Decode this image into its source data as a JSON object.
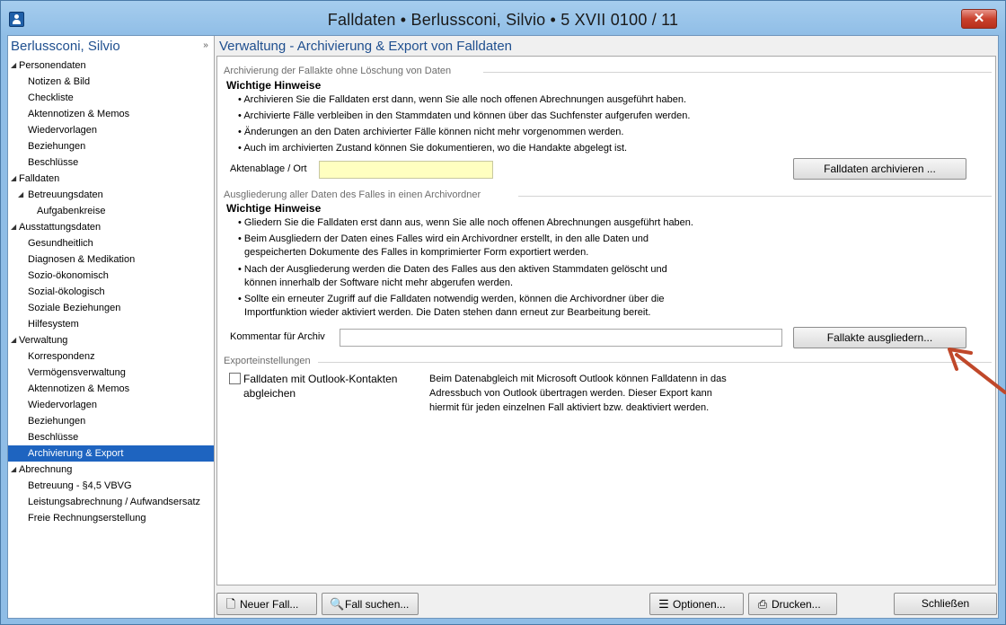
{
  "window": {
    "title": "Falldaten  •  Berlussconi, Silvio  •  5 XVII 0100 / 11",
    "close_label": "✕"
  },
  "sidebar": {
    "title": "Berlussconi, Silvio",
    "collapse_glyph": "»",
    "items": [
      {
        "label": "Personendaten",
        "level": 0,
        "arrow": "◢"
      },
      {
        "label": "Notizen & Bild",
        "level": 1
      },
      {
        "label": "Checkliste",
        "level": 1
      },
      {
        "label": "Aktennotizen & Memos",
        "level": 1
      },
      {
        "label": "Wiedervorlagen",
        "level": 1
      },
      {
        "label": "Beziehungen",
        "level": 1
      },
      {
        "label": "Beschlüsse",
        "level": 1
      },
      {
        "label": "Falldaten",
        "level": 0,
        "arrow": "◢"
      },
      {
        "label": "Betreuungsdaten",
        "level": 1,
        "arrow": "◢"
      },
      {
        "label": "Aufgabenkreise",
        "level": 2
      },
      {
        "label": "Ausstattungsdaten",
        "level": 0,
        "arrow": "◢"
      },
      {
        "label": "Gesundheitlich",
        "level": 1
      },
      {
        "label": "Diagnosen & Medikation",
        "level": 1
      },
      {
        "label": "Sozio-ökonomisch",
        "level": 1
      },
      {
        "label": "Sozial-ökologisch",
        "level": 1
      },
      {
        "label": "Soziale Beziehungen",
        "level": 1
      },
      {
        "label": "Hilfesystem",
        "level": 1
      },
      {
        "label": "Verwaltung",
        "level": 0,
        "arrow": "◢"
      },
      {
        "label": "Korrespondenz",
        "level": 1
      },
      {
        "label": "Vermögensverwaltung",
        "level": 1
      },
      {
        "label": "Aktennotizen & Memos",
        "level": 1
      },
      {
        "label": "Wiedervorlagen",
        "level": 1
      },
      {
        "label": "Beziehungen",
        "level": 1
      },
      {
        "label": "Beschlüsse",
        "level": 1
      },
      {
        "label": "Archivierung & Export",
        "level": 1,
        "selected": true
      },
      {
        "label": "Abrechnung",
        "level": 0,
        "arrow": "◢"
      },
      {
        "label": "Betreuung - §4,5 VBVG",
        "level": 1
      },
      {
        "label": "Leistungsabrechnung / Aufwandsersatz",
        "level": 1
      },
      {
        "label": "Freie Rechnungserstellung",
        "level": 1
      }
    ]
  },
  "main": {
    "page_title": "Verwaltung - Archivierung & Export von Falldaten",
    "archive": {
      "section_title": "Archivierung der Fallakte ohne Löschung von Daten",
      "hints_title": "Wichtige Hinweise",
      "hints": [
        "Archivieren Sie die Falldaten erst dann, wenn Sie alle noch offenen Abrechnungen ausgeführt haben.",
        "Archivierte Fälle verbleiben in den Stammdaten und können über das Suchfenster aufgerufen werden.",
        "Änderungen an den Daten archivierter Fälle können nicht mehr vorgenommen werden.",
        "Auch im archivierten Zustand können Sie dokumentieren, wo die Handakte abgelegt ist."
      ],
      "location_label": "Aktenablage / Ort",
      "location_value": "",
      "archive_button": "Falldaten archivieren ..."
    },
    "extract": {
      "section_title": "Ausgliederung aller Daten des Falles in einen Archivordner",
      "hints_title": "Wichtige Hinweise",
      "hint1": "Gliedern Sie die Falldaten erst dann aus, wenn Sie alle noch offenen Abrechnungen ausgeführt haben.",
      "hint2_line1": "Beim Ausgliedern der Daten eines Falles wird ein Archivordner erstellt, in den alle Daten und",
      "hint2_line2": "gespeicherten Dokumente des Falles in komprimierter Form exportiert werden.",
      "hint3_line1": "Nach der Ausgliederung werden die Daten des Falles aus den aktiven Stammdaten gelöscht und",
      "hint3_line2": "können innerhalb der Software nicht mehr abgerufen werden.",
      "hint4_line1": "Sollte ein erneuter Zugriff auf die Falldaten notwendig werden, können die Archivordner über die",
      "hint4_line2": "Importfunktion wieder aktiviert werden. Die Daten stehen dann erneut zur Bearbeitung bereit.",
      "comment_label": "Kommentar für Archiv",
      "comment_value": "",
      "extract_button": "Fallakte ausgliedern..."
    },
    "export": {
      "section_title": "Exporteinstellungen",
      "outlook_label_line1": "Falldaten mit Outlook-Kontakten",
      "outlook_label_line2": "abgleichen",
      "outlook_checked": false,
      "desc_line1": "Beim Datenabgleich mit Microsoft Outlook können Falldatenn in das",
      "desc_line2": "Adressbuch von Outlook übertragen werden. Dieser Export kann",
      "desc_line3": "hiermit für jeden einzelnen Fall aktiviert bzw. deaktiviert werden."
    }
  },
  "footer": {
    "new_case": "Neuer Fall...",
    "search_case": "Fall suchen...",
    "options": "Optionen...",
    "print": "Drucken...",
    "close": "Schließen"
  },
  "icons": {
    "new_case": "new-document-icon",
    "search_case": "magnifier-icon",
    "options": "options-icon",
    "print": "printer-icon"
  },
  "colors": {
    "accent": "#1e64c0",
    "title_blue": "#1f4f8f",
    "location_field": "#ffffc0",
    "annotation_arrow": "#c0482a"
  }
}
